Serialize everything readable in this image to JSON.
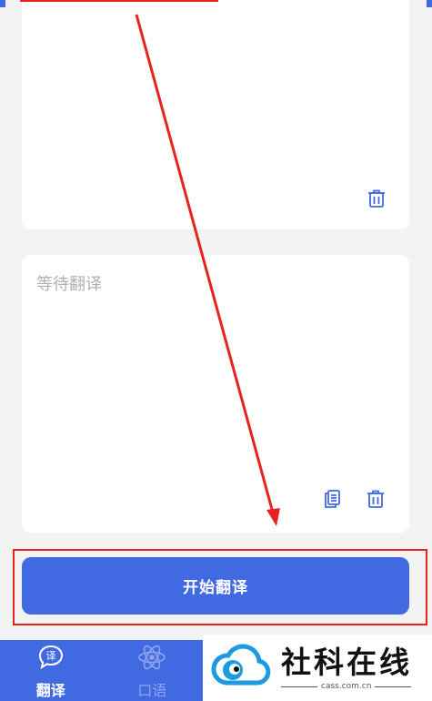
{
  "output_panel": {
    "placeholder": "等待翻译"
  },
  "translate_button": {
    "label": "开始翻译"
  },
  "bottom_nav": {
    "items": [
      {
        "label": "翻译",
        "icon": "translate-bubble-icon",
        "active": true
      },
      {
        "label": "口语",
        "icon": "atom-icon",
        "active": false
      }
    ]
  },
  "watermark": {
    "title": "社科在线",
    "domain": "cass.com.cn"
  },
  "colors": {
    "accent": "#4169e1",
    "annotation": "#e8231e",
    "page_bg": "#f3f3f3"
  }
}
